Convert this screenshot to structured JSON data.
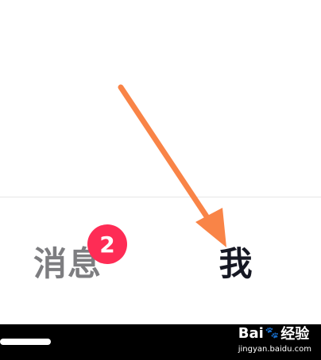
{
  "tab_bar": {
    "messages": {
      "label": "消息",
      "badge_count": "2"
    },
    "me": {
      "label": "我"
    }
  },
  "colors": {
    "badge": "#fe2c55",
    "arrow": "#f98447",
    "active_tab": "#161823",
    "inactive_tab": "#7d7d80"
  },
  "watermark": {
    "brand": "Bai",
    "brand_suffix": "经验",
    "url": "jingyan.baidu.com"
  },
  "annotation": {
    "type": "arrow",
    "icon": "arrow-pointer-icon"
  }
}
